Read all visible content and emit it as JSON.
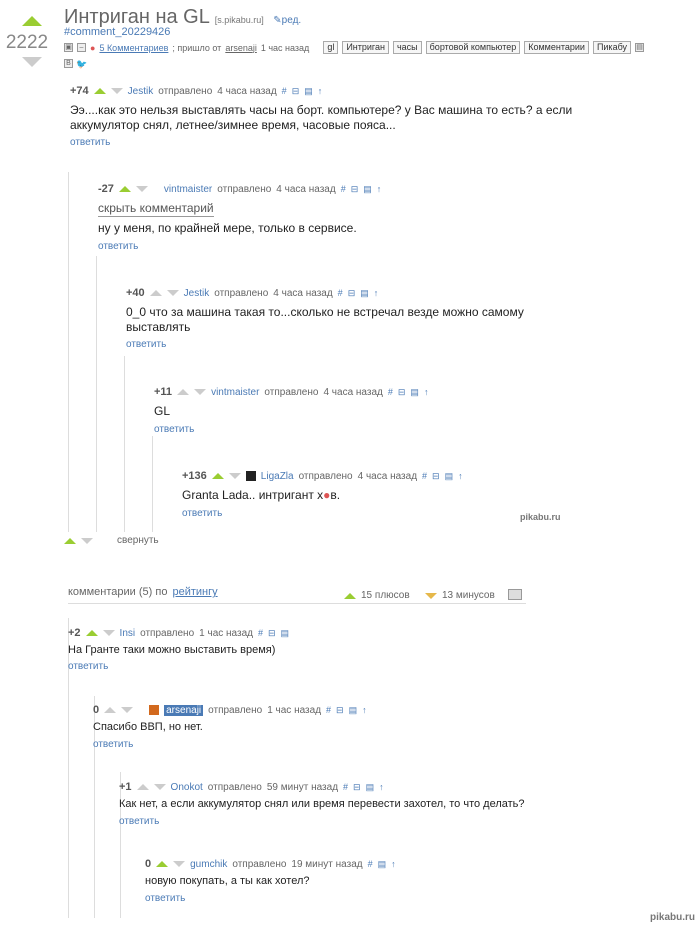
{
  "post": {
    "rating": "2222",
    "title": "Интриган на GL",
    "source": "[s.pikabu.ru]",
    "edit_label": "ред.",
    "anchor": "#comment_20229426",
    "comments_link": "5 Комментариев",
    "from_text": "; пришло от",
    "from_user": "arsenaji",
    "time": "1 час назад",
    "tags": [
      "gl",
      "Интриган",
      "часы",
      "бортовой компьютер",
      "Комментарии",
      "Пикабу"
    ]
  },
  "thread": [
    {
      "rating": "+74",
      "user": "Jestik",
      "sent": "отправлено",
      "time": "4 часа назад",
      "text": "Ээ....как это нельзя выставлять часы на борт. компьютере? у Вас машина то есть? а если аккумулятор снял, летнее/зимнее время, часовые пояса...",
      "reply": "ответить"
    },
    {
      "rating": "-27",
      "user": "vintmaister",
      "sent": "отправлено",
      "time": "4 часа назад",
      "hide": "скрыть комментарий",
      "text": "ну у меня, по крайней мере, только в сервисе.",
      "reply": "ответить"
    },
    {
      "rating": "+40",
      "user": "Jestik",
      "sent": "отправлено",
      "time": "4 часа назад",
      "text": "0_0 что за машина такая то...сколько не встречал везде можно самому выставлять",
      "reply": "ответить"
    },
    {
      "rating": "+11",
      "user": "vintmaister",
      "sent": "отправлено",
      "time": "4 часа назад",
      "text": "GL",
      "reply": "ответить"
    },
    {
      "rating": "+136",
      "user": "LigaZla",
      "sent": "отправлено",
      "time": "4 часа назад",
      "text": "Granta Lada.. интригант х",
      "text_end": "в.",
      "reply": "ответить"
    }
  ],
  "collapse_label": "свернуть",
  "watermark": "pikabu.ru",
  "sort": {
    "prefix": "комментарии (5) по",
    "by": "рейтингу",
    "plus": "15 плюсов",
    "minus": "13 минусов"
  },
  "comments": [
    {
      "rating": "+2",
      "user": "Insi",
      "sent": "отправлено",
      "time": "1 час назад",
      "text": "На Гранте таки можно выставить время)",
      "reply": "ответить"
    },
    {
      "rating": "0",
      "user": "arsenaji",
      "sent": "отправлено",
      "time": "1 час назад",
      "text": "Спасибо ВВП, но нет.",
      "reply": "ответить"
    },
    {
      "rating": "+1",
      "user": "Onokot",
      "sent": "отправлено",
      "time": "59 минут назад",
      "text": "Как нет, а если аккумулятор снял или время перевести захотел, то что делать?",
      "reply": "ответить"
    },
    {
      "rating": "0",
      "user": "gumchik",
      "sent": "отправлено",
      "time": "19 минут назад",
      "text": "новую покупать, а ты как хотел?",
      "reply": "ответить"
    }
  ],
  "colors": {
    "accent": "#4a7ab5",
    "up": "#9acd32",
    "down": "#cccccc"
  }
}
